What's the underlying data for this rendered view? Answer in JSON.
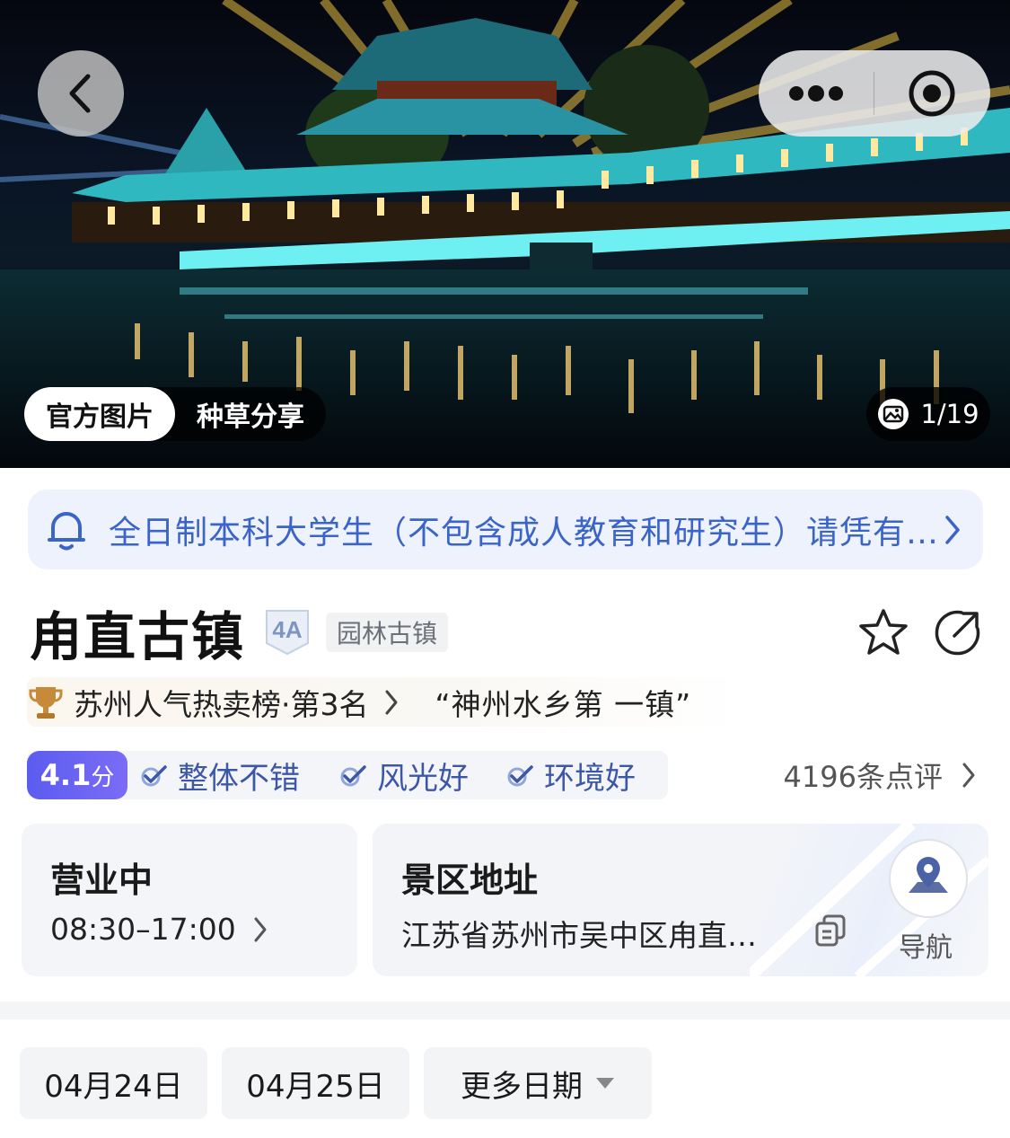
{
  "hero": {
    "photo_tabs": [
      {
        "label": "官方图片",
        "active": true
      },
      {
        "label": "种草分享",
        "active": false
      }
    ],
    "counter": "1/19"
  },
  "notice": {
    "text": "全日制本科大学生（不包含成人教育和研究生）请凭有…",
    "color": "#3b64c8"
  },
  "attraction": {
    "name": "甪直古镇",
    "grade": "4A",
    "category": "园林古镇"
  },
  "ranking": {
    "text": "苏州人气热卖榜·第3名",
    "slogan": "“神州水乡第 一镇”"
  },
  "rating": {
    "score": "4.1",
    "unit": "分",
    "tags": [
      "整体不错",
      "风光好",
      "环境好"
    ],
    "reviews": "4196条点评",
    "accent": "#5b5cf0"
  },
  "hours": {
    "status": "营业中",
    "time": "08:30–17:00"
  },
  "address": {
    "title": "景区地址",
    "text": "江苏省苏州市吴中区甪直…",
    "nav_label": "导航"
  },
  "dates": [
    {
      "label": "04月24日"
    },
    {
      "label": "04月25日"
    },
    {
      "label": "更多日期"
    }
  ]
}
